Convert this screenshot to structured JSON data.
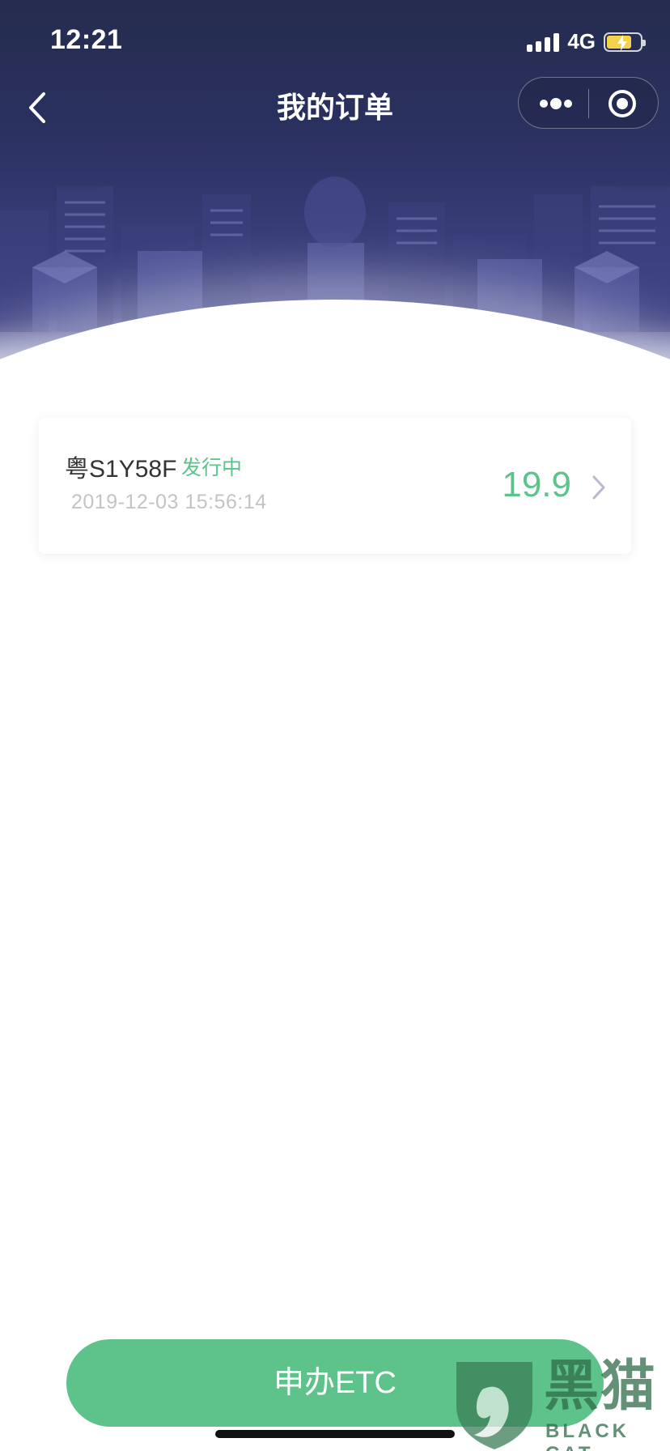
{
  "status_bar": {
    "time": "12:21",
    "network": "4G",
    "icons": [
      "signal-icon",
      "battery-charging-icon"
    ]
  },
  "nav": {
    "title": "我的订单",
    "icons": [
      "back-chevron-icon",
      "more-dots-icon",
      "close-target-icon"
    ]
  },
  "orders": [
    {
      "plate": "粤S1Y58F",
      "status": "发行中",
      "time": "2019-12-03 15:56:14",
      "price": "19.9"
    }
  ],
  "actions": {
    "apply_label": "申办ETC"
  },
  "watermark": {
    "brand": "黑猫",
    "brand_en": "BLACK CAT"
  },
  "colors": {
    "header_dark": "#252c4e",
    "header_mid": "#474a8e",
    "accent_green": "#5cc38a",
    "button_green": "#5ec28b",
    "watermark_green": "#2f6b49"
  }
}
